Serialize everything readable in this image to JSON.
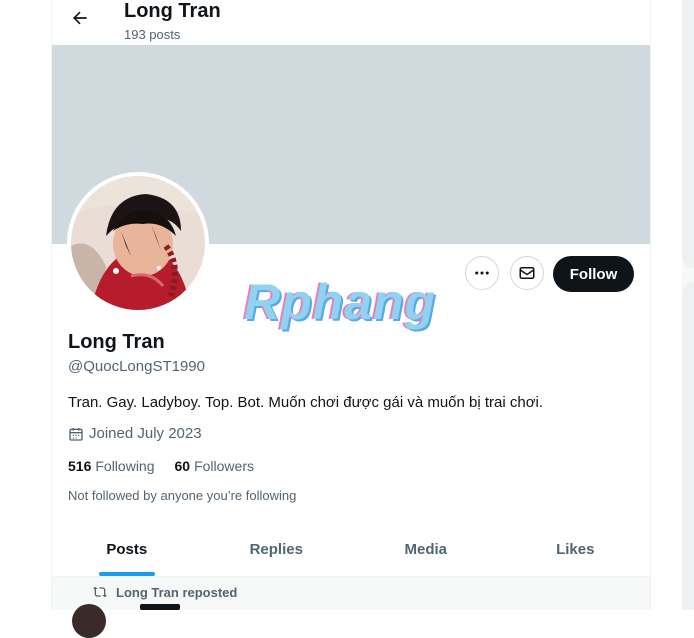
{
  "header": {
    "title": "Long Tran",
    "subtitle": "193 posts"
  },
  "profile": {
    "name": "Long Tran",
    "handle": "@QuocLongST1990",
    "bio": "Tran. Gay. Ladyboy. Top. Bot. Muốn chơi được gái và muốn bị trai chơi.",
    "joined": "Joined July 2023",
    "following_count": "516",
    "following_label": "Following",
    "followers_count": "60",
    "followers_label": "Followers",
    "not_followed": "Not followed by anyone you’re following"
  },
  "actions": {
    "follow_label": "Follow",
    "more_icon": "more-dots-icon",
    "message_icon": "mail-icon"
  },
  "watermark": "Rphang",
  "tabs": [
    {
      "label": "Posts",
      "active": true
    },
    {
      "label": "Replies",
      "active": false
    },
    {
      "label": "Media",
      "active": false
    },
    {
      "label": "Likes",
      "active": false
    }
  ],
  "feed": {
    "repost_label": "Long Tran reposted"
  },
  "colors": {
    "accent": "#1d9bf0",
    "banner": "#cfd9de",
    "follow_button": "#0f1419",
    "muted_text": "#536471"
  }
}
